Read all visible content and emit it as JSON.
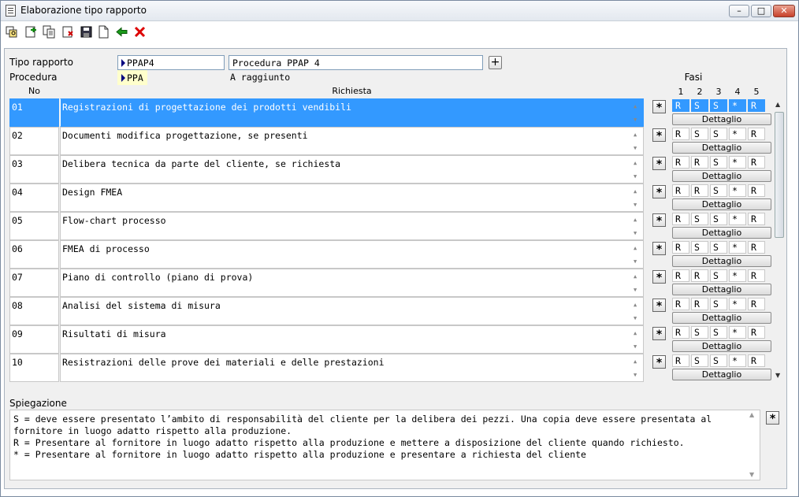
{
  "window": {
    "title": "Elaborazione tipo rapporto"
  },
  "toolbar": {
    "icons": [
      "search-records-icon",
      "new-record-icon",
      "copy-record-icon",
      "delete-record-icon",
      "save-icon",
      "blank-document-icon",
      "back-arrow-icon",
      "cancel-icon"
    ]
  },
  "header": {
    "tipo_label": "Tipo rapporto",
    "tipo_value": "PPAP4",
    "tipo_desc": "Procedura PPAP 4",
    "plus_label": "+",
    "procedura_label": "Procedura",
    "procedura_value": "PPA",
    "procedura_status": "A raggiunto"
  },
  "grid": {
    "col_no": "No",
    "col_req": "Richiesta",
    "fasi_label": "Fasi",
    "phase_headers": [
      "1",
      "2",
      "3",
      "4",
      "5"
    ],
    "detail_label": "Dettaglio",
    "star_label": "*",
    "rows": [
      {
        "no": "01",
        "req": "Registrazioni di progettazione dei prodotti vendibili",
        "phases": [
          "R",
          "S",
          "S",
          "*",
          "R"
        ],
        "selected": true
      },
      {
        "no": "02",
        "req": "Documenti modifica progettazione, se presenti",
        "phases": [
          "R",
          "S",
          "S",
          "*",
          "R"
        ]
      },
      {
        "no": "03",
        "req": "Delibera tecnica da parte del cliente, se richiesta",
        "phases": [
          "R",
          "R",
          "S",
          "*",
          "R"
        ]
      },
      {
        "no": "04",
        "req": "Design FMEA",
        "phases": [
          "R",
          "R",
          "S",
          "*",
          "R"
        ]
      },
      {
        "no": "05",
        "req": "Flow-chart processo",
        "phases": [
          "R",
          "S",
          "S",
          "*",
          "R"
        ]
      },
      {
        "no": "06",
        "req": "FMEA di processo",
        "phases": [
          "R",
          "S",
          "S",
          "*",
          "R"
        ]
      },
      {
        "no": "07",
        "req": "Piano di controllo (piano di prova)",
        "phases": [
          "R",
          "R",
          "S",
          "*",
          "R"
        ]
      },
      {
        "no": "08",
        "req": "Analisi del sistema di misura",
        "phases": [
          "R",
          "R",
          "S",
          "*",
          "R"
        ]
      },
      {
        "no": "09",
        "req": "Risultati di misura",
        "phases": [
          "R",
          "S",
          "S",
          "*",
          "R"
        ]
      },
      {
        "no": "10",
        "req": "Resistrazioni delle prove dei materiali e delle prestazioni",
        "phases": [
          "R",
          "S",
          "S",
          "*",
          "R"
        ]
      }
    ]
  },
  "explanation": {
    "label": "Spiegazione",
    "text": "S = deve essere presentato l’ambito di responsabilità del cliente per la delibera dei pezzi. Una copia deve essere presentata al\nfornitore in luogo adatto rispetto alla produzione.\nR = Presentare al fornitore in luogo adatto rispetto alla produzione e mettere a disposizione del cliente quando richiesto.\n* = Presentare al fornitore in luogo adatto rispetto alla produzione e presentare a richiesta del cliente",
    "star_label": "*"
  }
}
